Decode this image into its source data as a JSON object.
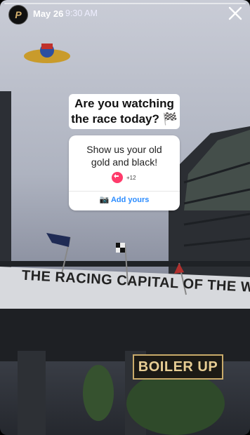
{
  "header": {
    "date": "May 26",
    "time": "9:30 AM",
    "avatar_letter": "P"
  },
  "question": {
    "line1": "Are you watching",
    "line2": "the race today?",
    "emoji": "🏁"
  },
  "card": {
    "line1": "Show us your old",
    "line2": "gold and black!",
    "count": "+12",
    "add_label": "Add yours"
  },
  "banner": {
    "text": "THE RACING CAPITAL OF THE WORLD"
  },
  "sticker": {
    "text": "BOILER UP"
  },
  "colors": {
    "accent": "#2b8cff",
    "brand_gold": "#c9aa6a",
    "badge_pink": "#ff3b6b"
  }
}
